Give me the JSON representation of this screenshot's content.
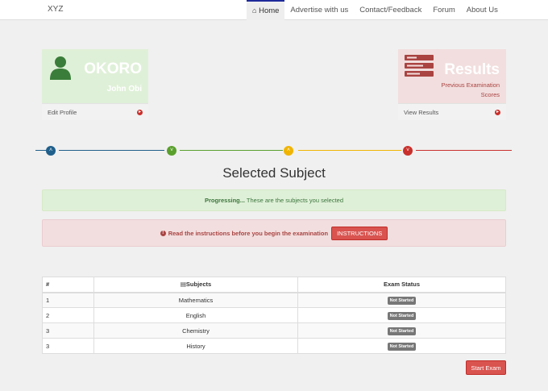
{
  "navbar": {
    "brand": "XYZ",
    "home_icon": "⌂",
    "items": [
      {
        "label": "Home"
      },
      {
        "label": "Advertise with us"
      },
      {
        "label": "Contact/Feedback"
      },
      {
        "label": "Forum"
      },
      {
        "label": "About Us"
      }
    ]
  },
  "profile_panel": {
    "name": "OKORO",
    "subname": "John Obi",
    "footer_link": "Edit Profile",
    "arrow_icon": "▸",
    "icon": "user-icon"
  },
  "results_panel": {
    "title": "Results",
    "subtitle_line1": "Previous Examination",
    "subtitle_line2": "Scores",
    "footer_link": "View Results",
    "arrow_icon": "▸",
    "icon": "list-icon"
  },
  "stepper": {
    "steps": [
      {
        "icon": "˄",
        "color": "#1f5f8b"
      },
      {
        "icon": "˅",
        "color": "#5aa02c"
      },
      {
        "icon": "˄",
        "color": "#f0b400"
      },
      {
        "icon": "˅",
        "color": "#c9302c"
      }
    ]
  },
  "heading": "Selected Subject",
  "alerts": {
    "progress_strong": "Progressing...",
    "progress_text": " These are the subjects you selected",
    "instruction_icon": "!",
    "instruction_text": "Read the instructions before you begin the examination",
    "instruction_button": "INSTRUCTIONS"
  },
  "table": {
    "columns": {
      "num": "#",
      "subject_icon": "▤",
      "subject": "Subjects",
      "status": "Exam Status"
    },
    "rows": [
      {
        "num": "1",
        "subject": "Mathematics",
        "status": "Not Started"
      },
      {
        "num": "2",
        "subject": "English",
        "status": "Not Started"
      },
      {
        "num": "3",
        "subject": "Chemistry",
        "status": "Not Started"
      },
      {
        "num": "3",
        "subject": "History",
        "status": "Not Started"
      }
    ]
  },
  "start_button": "Start Exam",
  "colors": {
    "accent_red": "#d9534f",
    "success_bg": "#dff0d8",
    "danger_bg": "#f2dede",
    "nav_active_border": "#1e2a9a"
  }
}
